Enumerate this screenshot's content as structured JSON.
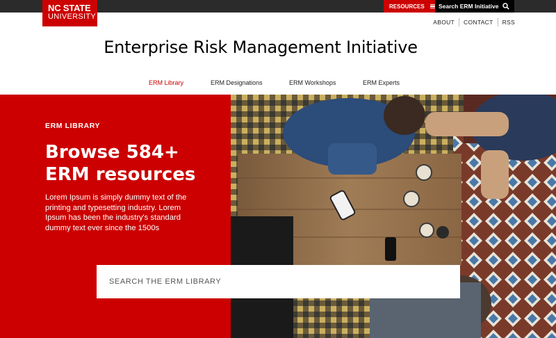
{
  "header": {
    "logo_line1": "NC STATE",
    "logo_line2": "UNIVERSITY",
    "resources_label": "RESOURCES",
    "search_label": "Search ERM Initiative",
    "util_links": [
      "ABOUT",
      "CONTACT",
      "RSS"
    ]
  },
  "site_title": "Enterprise Risk Management Initiative",
  "nav": {
    "items": [
      {
        "label": "ERM Library",
        "active": true
      },
      {
        "label": "ERM Designations",
        "active": false
      },
      {
        "label": "ERM Workshops",
        "active": false
      },
      {
        "label": "ERM Experts",
        "active": false
      }
    ]
  },
  "hero": {
    "label": "ERM LIBRARY",
    "heading": "Browse 584+ ERM resources",
    "body": "Lorem Ipsum is simply dummy text of the printing and typesetting industry. Lorem Ipsum has been the industry's standard dummy text ever since the 1500s",
    "search_placeholder": "SEARCH THE ERM LIBRARY"
  },
  "colors": {
    "brand_red": "#cc0000",
    "topbar": "#2b2b2b",
    "search_bg": "#000000"
  },
  "icons": [
    "hamburger-icon",
    "search-icon"
  ]
}
